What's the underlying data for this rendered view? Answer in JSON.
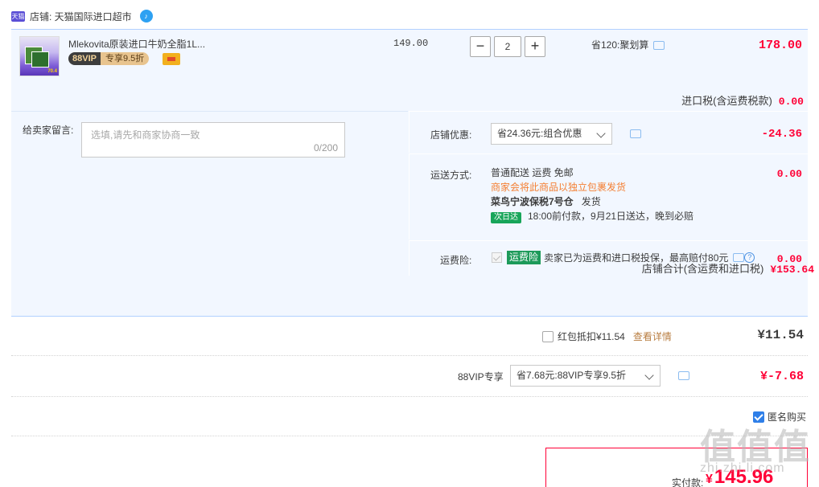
{
  "shop": {
    "badge": "天猫",
    "label": "店铺: 天猫国际进口超市"
  },
  "item": {
    "title": "Mlekovita原装进口牛奶全脂1L...",
    "vip_left": "88VIP",
    "vip_right": "专享9.5折",
    "unit_price": "149.00",
    "qty_minus": "−",
    "qty": "2",
    "qty_plus": "+",
    "saving": "省120:聚划算",
    "total": "178.00",
    "import_tax_label": "进口税(含运费税款)",
    "import_tax": "0.00"
  },
  "message": {
    "label": "给卖家留言:",
    "placeholder": "选填,请先和商家协商一致",
    "count": "0/200"
  },
  "coupon": {
    "label": "店铺优惠:",
    "value": "省24.36元:组合优惠",
    "amount": "-24.36"
  },
  "shipping": {
    "label": "运送方式:",
    "line1": "普通配送 运费 免邮",
    "line2": "商家会将此商品以独立包裹发货",
    "warehouse": "菜鸟宁波保税7号仓",
    "ship_word": "发货",
    "badge": "次日达",
    "eta": "18:00前付款，9月21日送达，晚到必赔",
    "amount": "0.00"
  },
  "insurance": {
    "label": "运费险:",
    "tag": "运费险",
    "desc": "卖家已为运费和进口税投保，最高赔付80元",
    "amount": "0.00"
  },
  "shop_total": {
    "label": "店铺合计(含运费和进口税)",
    "value": "¥153.64"
  },
  "redpack": {
    "label": "红包抵扣¥11.54",
    "link": "查看详情",
    "amount": "¥11.54"
  },
  "vip_discount": {
    "label": "88VIP专享",
    "value": "省7.68元:88VIP专享9.5折",
    "amount": "¥-7.68"
  },
  "anonymous": {
    "label": "匿名购买"
  },
  "pay": {
    "label": "实付款:",
    "currency": "¥",
    "amount": "145.96"
  },
  "watermark": {
    "main": "值值值",
    "sub": "zhi.zhi.li.com"
  },
  "colors": {
    "accent": "#ff0036",
    "panel": "#f2f7ff",
    "vip_gold": "#e8c48f",
    "nextday_green": "#18a55a"
  }
}
